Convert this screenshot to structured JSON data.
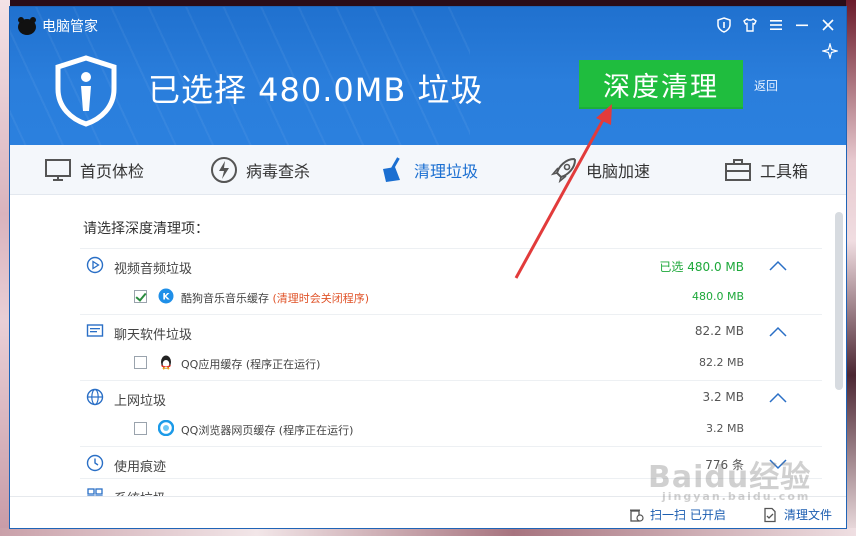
{
  "window": {
    "title": "电脑管家"
  },
  "header": {
    "headline": "已选择 480.0MB 垃圾",
    "deep_clean_label": "深度清理",
    "back_label": "返回"
  },
  "nav": {
    "items": [
      {
        "label": "首页体检",
        "icon": "monitor-icon"
      },
      {
        "label": "病毒查杀",
        "icon": "lightning-icon"
      },
      {
        "label": "清理垃圾",
        "icon": "broom-icon",
        "active": true
      },
      {
        "label": "电脑加速",
        "icon": "rocket-icon"
      },
      {
        "label": "工具箱",
        "icon": "toolbox-icon"
      }
    ]
  },
  "content": {
    "section_title": "请选择深度清理项：",
    "categories": [
      {
        "label": "视频音频垃圾",
        "size": "已选 480.0 MB",
        "expanded": true,
        "item": {
          "label": "酷狗音乐音乐缓存",
          "note": "(清理时会关闭程序)",
          "size": "480.0 MB",
          "checked": true
        }
      },
      {
        "label": "聊天软件垃圾",
        "size": "82.2 MB",
        "expanded": true,
        "item": {
          "label": "QQ应用缓存 (程序正在运行)",
          "size": "82.2 MB",
          "checked": false
        }
      },
      {
        "label": "上网垃圾",
        "size": "3.2 MB",
        "expanded": true,
        "item": {
          "label": "QQ浏览器网页缓存 (程序正在运行)",
          "size": "3.2 MB",
          "checked": false
        }
      },
      {
        "label": "使用痕迹",
        "size": "776 条",
        "expanded": false
      },
      {
        "label": "系统垃圾"
      }
    ]
  },
  "footer": {
    "left_label": "扫一扫 已开启",
    "right_label": "清理文件"
  },
  "watermark": {
    "brand": "Baidu经验",
    "sub": "jingyan.baidu.com"
  },
  "colors": {
    "header_blue": "#2a7edc",
    "button_green": "#1fbd3e",
    "active_nav": "#1b6fd1",
    "size_green": "#1da83a",
    "note_orange": "#e0542a",
    "arrow_red": "#e23b3b"
  }
}
